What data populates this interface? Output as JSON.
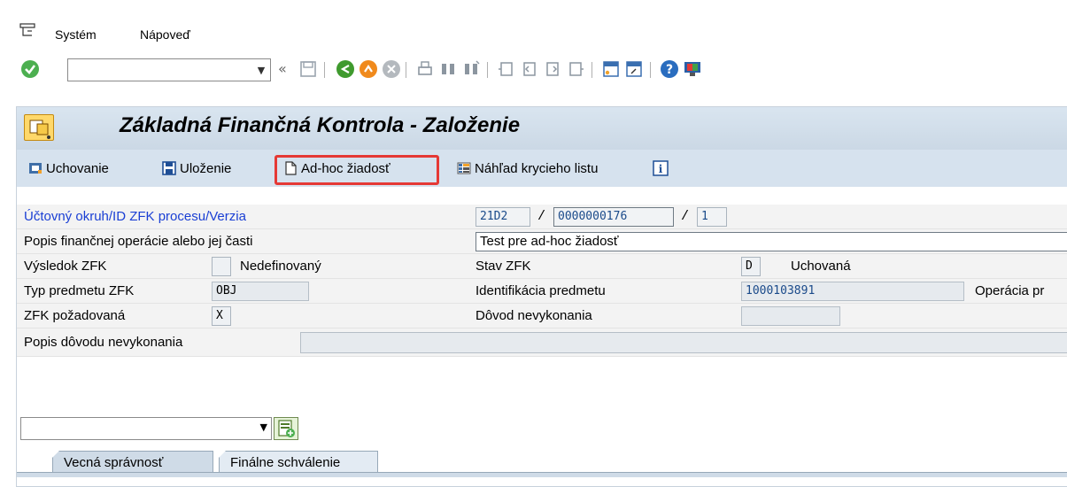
{
  "menubar": {
    "icon": "menu-icon",
    "items": [
      {
        "label": "Systém"
      },
      {
        "label": "Nápoveď"
      }
    ]
  },
  "toolbar": {
    "command_field": {
      "value": "",
      "placeholder": ""
    },
    "icons": [
      "check-icon",
      "back-double-icon",
      "save-icon",
      "back-green-icon",
      "exit-orange-icon",
      "cancel-grey-icon",
      "print-icon",
      "find-icon",
      "find-next-icon",
      "first-page-icon",
      "prev-page-icon",
      "next-page-icon",
      "last-page-icon",
      "new-session-icon",
      "shortcut-icon",
      "help-icon",
      "customize-icon"
    ]
  },
  "title": {
    "text": "Základná Finančná Kontrola - Založenie",
    "icon": "transaction-icon"
  },
  "app_toolbar": {
    "buttons": [
      {
        "label": "Uchovanie",
        "icon": "hold-icon"
      },
      {
        "label": "Uloženie",
        "icon": "save-icon"
      },
      {
        "label": "Ad-hoc žiadosť",
        "icon": "document-icon",
        "highlighted": true
      },
      {
        "label": "Náhľad krycieho listu",
        "icon": "preview-icon"
      },
      {
        "label": "",
        "icon": "info-icon"
      }
    ]
  },
  "form": {
    "row1": {
      "label": "Účtovný okruh/ID ZFK procesu/Verzia",
      "company_code": "21D2",
      "sep1": "/",
      "process_id": "0000000176",
      "sep2": "/",
      "version": "1"
    },
    "row2": {
      "label": "Popis finančnej operácie alebo jej časti",
      "value": "Test pre ad-hoc žiadosť"
    },
    "row3": {
      "label": "Výsledok ZFK",
      "result_code": "",
      "result_text": "Nedefinovaný",
      "status_label": "Stav ZFK",
      "status_code": "D",
      "status_text": "Uchovaná"
    },
    "row4": {
      "label": "Typ predmetu ZFK",
      "type_value": "OBJ",
      "subject_label": "Identifikácia predmetu",
      "subject_value": "1000103891",
      "operation_label": "Operácia pr"
    },
    "row5": {
      "label": "ZFK požadovaná",
      "required_value": "X",
      "reason_label": "Dôvod nevykonania",
      "reason_value": ""
    },
    "row6": {
      "label": "Popis dôvodu nevykonania",
      "value": ""
    }
  },
  "variant_select": {
    "value": ""
  },
  "tabs": [
    {
      "label": "Vecná správnosť",
      "active": true
    },
    {
      "label": "Finálne schválenie",
      "active": false
    }
  ]
}
